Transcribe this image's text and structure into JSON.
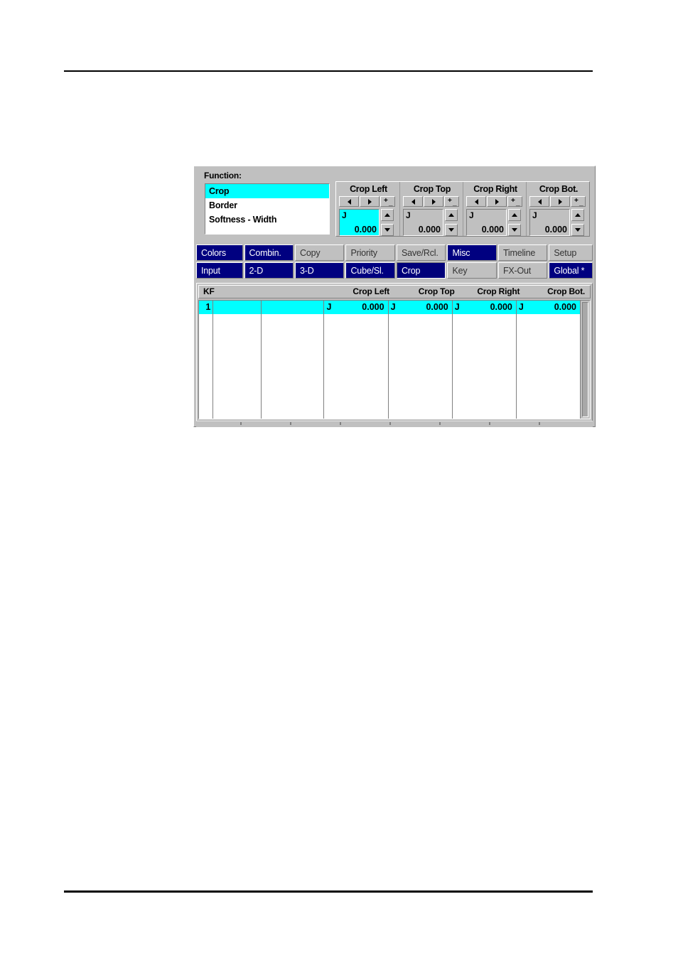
{
  "dialog": {
    "function_panel": {
      "label": "Function:",
      "items": [
        {
          "label": "Crop",
          "selected": true
        },
        {
          "label": "Border",
          "selected": false
        },
        {
          "label": "Softness - Width",
          "selected": false
        }
      ]
    },
    "spinners": [
      {
        "title": "Crop Left",
        "prefix": "J",
        "value": "0.000",
        "active": true,
        "dec_icon": "arrow-left-icon",
        "inc_icon": "arrow-right-icon",
        "pm_label": "+-",
        "up_icon": "arrow-up-icon",
        "down_icon": "arrow-down-icon"
      },
      {
        "title": "Crop Top",
        "prefix": "J",
        "value": "0.000",
        "active": false,
        "dec_icon": "arrow-left-icon",
        "inc_icon": "arrow-right-icon",
        "pm_label": "+-",
        "up_icon": "arrow-up-icon",
        "down_icon": "arrow-down-icon"
      },
      {
        "title": "Crop Right",
        "prefix": "J",
        "value": "0.000",
        "active": false,
        "dec_icon": "arrow-left-icon",
        "inc_icon": "arrow-right-icon",
        "pm_label": "+-",
        "up_icon": "arrow-up-icon",
        "down_icon": "arrow-down-icon"
      },
      {
        "title": "Crop Bot.",
        "prefix": "J",
        "value": "0.000",
        "active": false,
        "dec_icon": "arrow-left-icon",
        "inc_icon": "arrow-right-icon",
        "pm_label": "+-",
        "up_icon": "arrow-up-icon",
        "down_icon": "arrow-down-icon"
      }
    ],
    "tabs_row1": [
      {
        "label": "Colors",
        "state": "on"
      },
      {
        "label": "Combin.",
        "state": "on"
      },
      {
        "label": "Copy",
        "state": "off"
      },
      {
        "label": "Priority",
        "state": "off"
      },
      {
        "label": "Save/Rcl.",
        "state": "off"
      },
      {
        "label": "Misc",
        "state": "on"
      },
      {
        "label": "Timeline",
        "state": "off"
      },
      {
        "label": "Setup",
        "state": "off"
      }
    ],
    "tabs_row2": [
      {
        "label": "Input",
        "state": "on"
      },
      {
        "label": "2-D",
        "state": "on"
      },
      {
        "label": "3-D",
        "state": "on"
      },
      {
        "label": "Cube/Sl.",
        "state": "on"
      },
      {
        "label": "Crop",
        "state": "current"
      },
      {
        "label": "Key",
        "state": "off"
      },
      {
        "label": "FX-Out",
        "state": "off"
      },
      {
        "label": "Global *",
        "state": "on"
      }
    ],
    "table": {
      "headers": {
        "kf": "KF",
        "crop_left": "Crop Left",
        "crop_top": "Crop Top",
        "crop_right": "Crop Right",
        "crop_bot": "Crop Bot."
      },
      "rows": [
        {
          "kf": "1",
          "selected": true,
          "blank1": "",
          "blank2": "",
          "crop_left": {
            "prefix": "J",
            "value": "0.000"
          },
          "crop_top": {
            "prefix": "J",
            "value": "0.000"
          },
          "crop_right": {
            "prefix": "J",
            "value": "0.000"
          },
          "crop_bot": {
            "prefix": "J",
            "value": "0.000"
          }
        }
      ]
    }
  },
  "colors": {
    "face": "#c0c0c0",
    "highlight_cyan": "#00ffff",
    "tab_active_navy": "#000080",
    "tab_current_navy": "#00007a",
    "window_white": "#ffffff",
    "shadow": "#808080",
    "rule_black": "#000000"
  }
}
